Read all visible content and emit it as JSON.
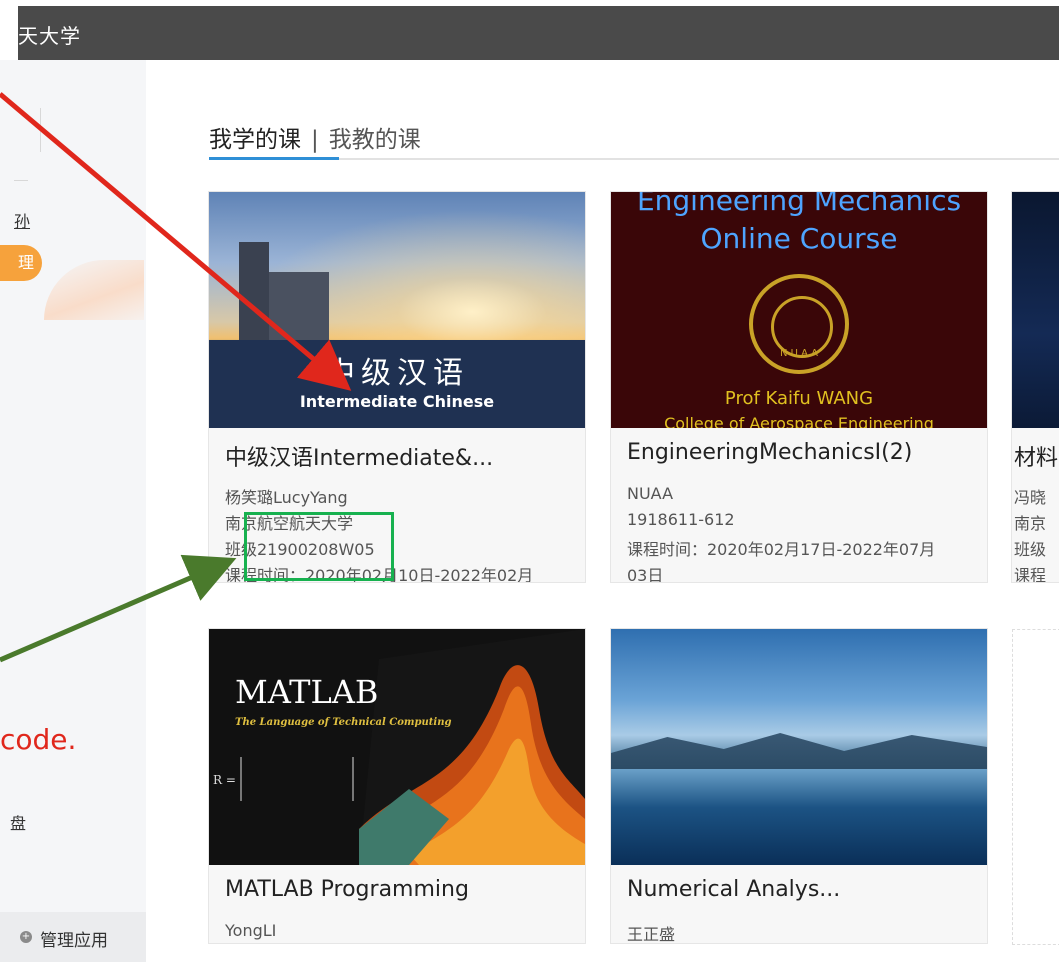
{
  "header": {
    "title": "天大学"
  },
  "sidebar": {
    "link": "孙",
    "badge": "理",
    "note": "code.",
    "drive": "盘",
    "manage_label": "管理应用"
  },
  "tabs": {
    "active": "我学的课",
    "separator": "|",
    "inactive": "我教的课"
  },
  "courses": [
    {
      "cover_cn": "中级汉语",
      "cover_en": "Intermediate  Chinese",
      "title": "中级汉语Intermediate&...",
      "line1": "杨笑璐LucyYang",
      "line2": "南京航空航天大学",
      "line3": "班级21900208W05",
      "line4": "课程时间：2020年02月10日-2022年02月"
    },
    {
      "cover_line1": "Engineering Mechanics",
      "cover_line2": "Online Course",
      "cover_seal": "N U A A",
      "cover_prof": "Prof Kaifu WANG",
      "cover_college": "College of Aerospace Engineering",
      "title": "EngineeringMechanicsI(2)",
      "line1": "NUAA",
      "line2": "1918611-612",
      "line3": "课程时间：2020年02月17日-2022年07月",
      "line4": "03日"
    },
    {
      "title": "材料",
      "line1": "冯晓",
      "line2": "南京",
      "line3": "班级",
      "line4": "课程"
    },
    {
      "cover_title": "MATLAB",
      "cover_sub": "The Language of Technical Computing",
      "title": "MATLAB Programming",
      "line1": "YongLI"
    },
    {
      "title": "Numerical Analys...",
      "line1": "王正盛"
    }
  ],
  "colors": {
    "accent": "#2f8fd6",
    "badge": "#f6a23c",
    "annotation_red": "#e0271c",
    "annotation_green": "#17b14f"
  }
}
